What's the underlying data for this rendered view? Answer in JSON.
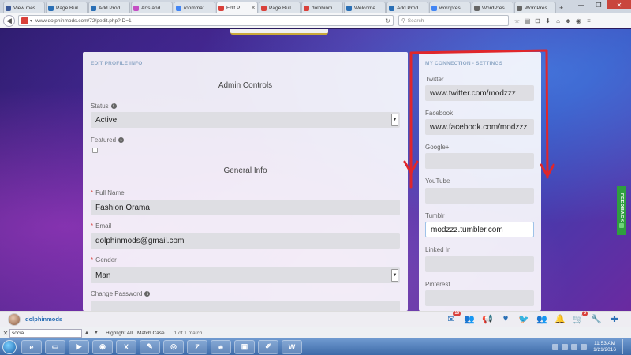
{
  "browser": {
    "tabs": [
      {
        "label": "View mes...",
        "color": "#3b5998",
        "active": false
      },
      {
        "label": "Page Buil...",
        "color": "#2a6fb5",
        "active": false
      },
      {
        "label": "Add Prod...",
        "color": "#2a6fb5",
        "active": false
      },
      {
        "label": "Arts and ...",
        "color": "#c44fc4",
        "active": false
      },
      {
        "label": "roommat...",
        "color": "#4285f4",
        "active": false
      },
      {
        "label": "Edit P...",
        "color": "#d9403a",
        "active": true
      },
      {
        "label": "Page Buil...",
        "color": "#d9403a",
        "active": false
      },
      {
        "label": "dolphinm...",
        "color": "#d9403a",
        "active": false
      },
      {
        "label": "Welcome...",
        "color": "#2a6fb5",
        "active": false
      },
      {
        "label": "Add Prod...",
        "color": "#2a6fb5",
        "active": false
      },
      {
        "label": "wordpres...",
        "color": "#4285f4",
        "active": false
      },
      {
        "label": "WordPres...",
        "color": "#666666",
        "active": false
      },
      {
        "label": "WordPres...",
        "color": "#666666",
        "active": false
      }
    ],
    "tab_close": "✕",
    "new_tab": "+",
    "url": "www.dolphinmods.com/72/pedit.php?ID=1",
    "search_placeholder": "Search"
  },
  "page": {
    "left": {
      "section": "EDIT PROFILE INFO",
      "admin_heading": "Admin Controls",
      "status_label": "Status",
      "status_value": "Active",
      "featured_label": "Featured",
      "general_heading": "General Info",
      "fullname_label": "Full Name",
      "fullname_value": "Fashion Orama",
      "email_label": "Email",
      "email_value": "dolphinmods@gmail.com",
      "gender_label": "Gender",
      "gender_value": "Man",
      "password_label": "Change Password",
      "required_mark": "*",
      "info_glyph": "i"
    },
    "right": {
      "section": "MY CONNECTION - SETTINGS",
      "twitter_label": "Twitter",
      "twitter_value": "www.twitter.com/modzzz",
      "facebook_label": "Facebook",
      "facebook_value": "www.facebook.com/modzzz",
      "googleplus_label": "Google+",
      "googleplus_value": "",
      "youtube_label": "YouTube",
      "youtube_value": "",
      "tumblr_label": "Tumblr",
      "tumblr_value": "modzzz.tumbler.com",
      "linkedin_label": "Linked In",
      "linkedin_value": "",
      "pinterest_label": "Pinterest",
      "pinterest_value": ""
    },
    "feedback_label": "FEEDBACK",
    "annotation_color": "#e0262b"
  },
  "socialbar": {
    "username": "dolphinmods",
    "mail_badge": "16",
    "cart_badge": "3"
  },
  "findbar": {
    "query": "socia",
    "highlight_all": "Highlight All",
    "match_case": "Match Case",
    "result": "1 of 1 match"
  },
  "taskbar": {
    "time": "11:53 AM",
    "date": "1/21/2016"
  }
}
